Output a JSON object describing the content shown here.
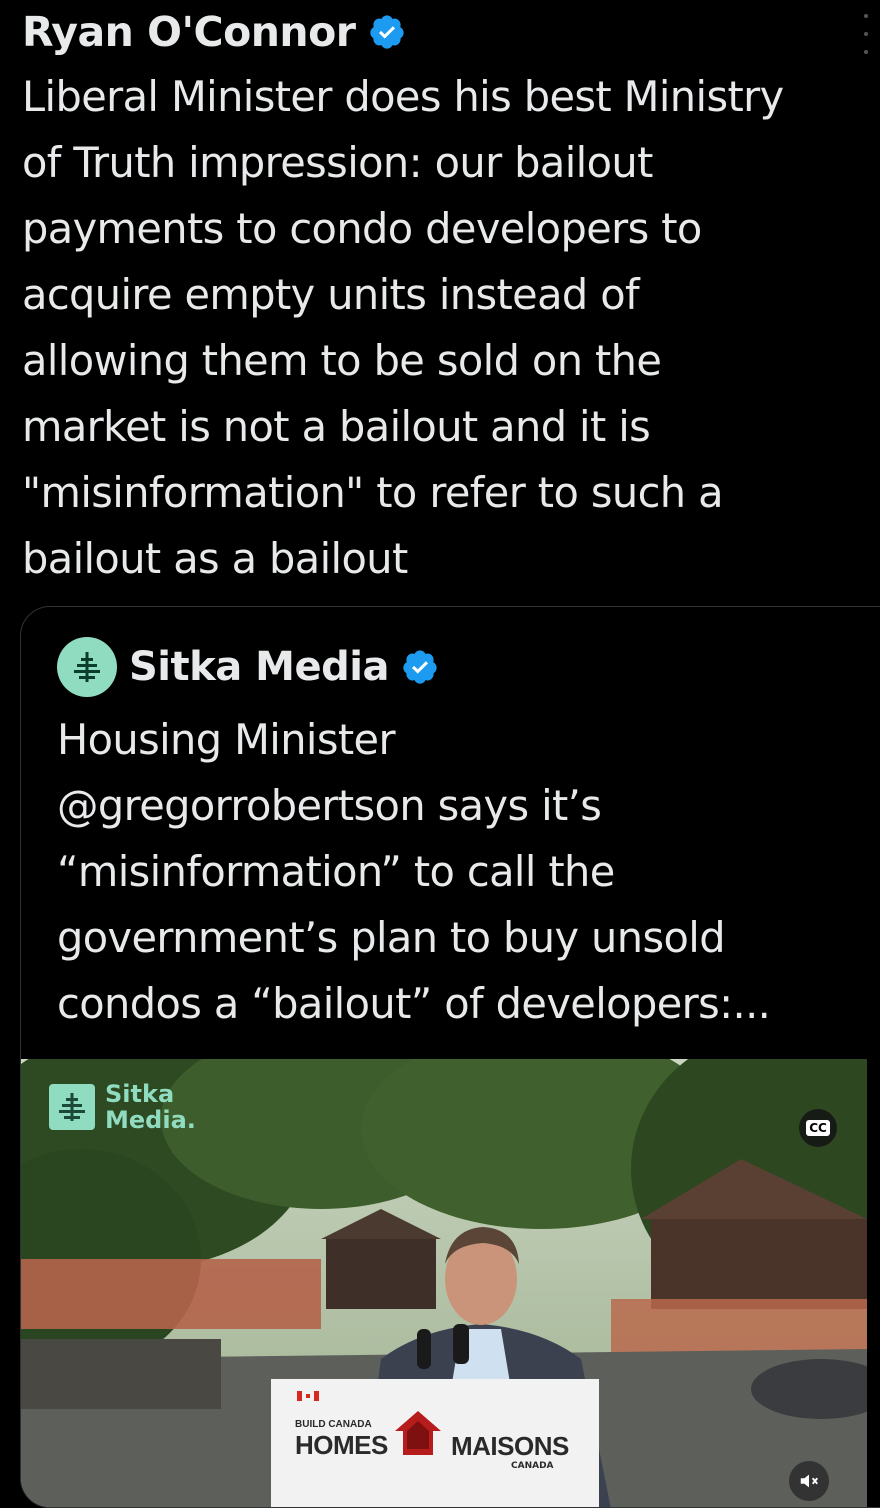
{
  "post": {
    "author_name": "Ryan O'Connor",
    "verified_icon": "verified-badge-icon",
    "more_icon": "more-options-icon",
    "text": "Liberal Minister does his best Ministry\nof Truth impression: our bailout\npayments to condo developers to\nacquire empty units instead of\nallowing them to be sold on the\nmarket is not a bailout and it is\n\"misinformation\" to refer to such a\nbailout as a bailout"
  },
  "quote": {
    "author_name": "Sitka Media",
    "avatar_icon": "sitka-tree-logo-icon",
    "text": "Housing Minister\n@gregorrobertson says it’s\n“misinformation” to call the\ngovernment’s plan to buy unsold\ncondos a “bailout” of developers:...",
    "video": {
      "watermark": "Sitka\nMedia.",
      "cc_label": "CC",
      "podium_small": "BUILD CANADA",
      "podium_homes": "HOMES",
      "podium_maisons": "MAISONS",
      "podium_canada": "CANADA",
      "mute_icon": "speaker-muted-icon"
    }
  },
  "colors": {
    "background": "#000000",
    "text": "#e7e9ea",
    "verified_blue": "#1d9bf0",
    "sitka_mint": "#8fdcc0",
    "border": "#2f3336"
  }
}
